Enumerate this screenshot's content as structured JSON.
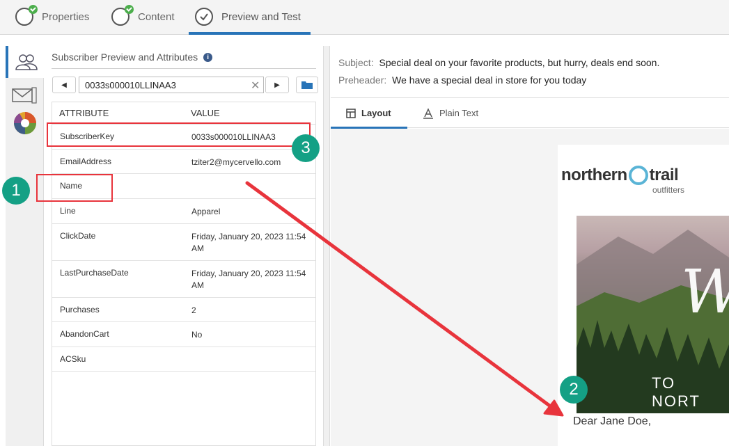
{
  "top_tabs": [
    {
      "label": "Properties"
    },
    {
      "label": "Content"
    },
    {
      "label": "Preview and Test"
    }
  ],
  "panel": {
    "title": "Subscriber Preview and Attributes",
    "info_glyph": "i",
    "subscriber_value": "0033s000010LLINAA3",
    "clear_glyph": "✕",
    "prev_glyph": "◀",
    "next_glyph": "▶"
  },
  "attributes": {
    "col_attribute": "ATTRIBUTE",
    "col_value": "VALUE",
    "rows": [
      {
        "key": "SubscriberKey",
        "value": "0033s000010LLINAA3"
      },
      {
        "key": "EmailAddress",
        "value": "tziter2@mycervello.com"
      },
      {
        "key": "Name",
        "value": ""
      },
      {
        "key": "Line",
        "value": "Apparel"
      },
      {
        "key": "ClickDate",
        "value": "Friday, January 20, 2023 11:54 AM"
      },
      {
        "key": "LastPurchaseDate",
        "value": "Friday, January 20, 2023 11:54 AM"
      },
      {
        "key": "Purchases",
        "value": "2"
      },
      {
        "key": "AbandonCart",
        "value": "No"
      },
      {
        "key": "ACSku",
        "value": ""
      }
    ]
  },
  "preview": {
    "subject_label": "Subject:",
    "subject_value": "Special deal on your favorite products, but hurry, deals end soon.",
    "preheader_label": "Preheader:",
    "preheader_value": "We have a special deal in store for you today",
    "tab_layout": "Layout",
    "tab_plain_text": "Plain Text"
  },
  "email": {
    "logo_left": "northern",
    "logo_right": "trail",
    "logo_sub": "outfitters",
    "hero_text": "TO NORT",
    "hero_script": "W",
    "greeting": "Dear Jane Doe,"
  },
  "callouts": {
    "one": "1",
    "two": "2",
    "three": "3"
  },
  "colors": {
    "accent": "#2874b8",
    "callout": "#14a085",
    "highlight": "#e8343c"
  },
  "icons": [
    "subscriber-icon",
    "email-settings-icon",
    "color-wheel-icon",
    "folder-icon",
    "layout-icon",
    "text-icon"
  ]
}
